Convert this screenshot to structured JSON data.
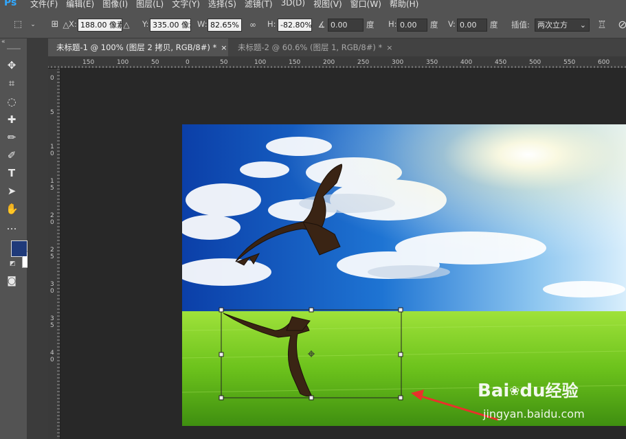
{
  "app": {
    "logo": "Ps"
  },
  "menu": [
    "文件(F)",
    "编辑(E)",
    "图像(I)",
    "图层(L)",
    "文字(Y)",
    "选择(S)",
    "滤镜(T)",
    "3D(D)",
    "视图(V)",
    "窗口(W)",
    "帮助(H)"
  ],
  "options": {
    "x_label": "X:",
    "x_value": "188.00 像素",
    "y_label": "Y:",
    "y_value": "335.00 像素",
    "w_label": "W:",
    "w_value": "82.65%",
    "h_label": "H:",
    "h_value": "-82.80%",
    "angle_value": "0.00",
    "angle_unit": "度",
    "hskew_label": "H:",
    "hskew_value": "0.00",
    "hskew_unit": "度",
    "vskew_label": "V:",
    "vskew_value": "0.00",
    "vskew_unit": "度",
    "interp_label": "插值:",
    "interp_value": "两次立方"
  },
  "tabs": [
    {
      "label": "未标题-1 @ 100% (图层 2 拷贝, RGB/8#) *",
      "close": "×"
    },
    {
      "label": "未标题-2 @ 60.6% (图层 1, RGB/8#) *",
      "close": "×"
    }
  ],
  "ruler": {
    "h_ticks": [
      "150",
      "100",
      "50",
      "0",
      "50",
      "100",
      "150",
      "200",
      "250",
      "300",
      "350",
      "400",
      "450",
      "500",
      "550",
      "600"
    ],
    "v_ticks": [
      "0",
      "5",
      "1 0",
      "1 5",
      "2 0",
      "2 5",
      "3 0",
      "3 5",
      "4 0"
    ]
  },
  "watermark": {
    "brand": "Bai",
    "brand2": "du",
    "sub": "经验",
    "url": "jingyan.baidu.com"
  },
  "colors": {
    "foreground": "#1f3a7a",
    "background": "#ffffff",
    "accent_arrow": "#e8322b"
  },
  "icons": [
    "move-icon",
    "marquee-icon",
    "crop-icon",
    "lasso-icon",
    "quick-select-icon",
    "eyedropper-icon",
    "healing-icon",
    "brush-icon",
    "stamp-icon",
    "history-brush-icon",
    "eraser-icon",
    "bucket-icon",
    "type-icon",
    "pen-icon",
    "path-select-icon",
    "ellipse-icon",
    "hand-icon",
    "zoom-icon"
  ]
}
